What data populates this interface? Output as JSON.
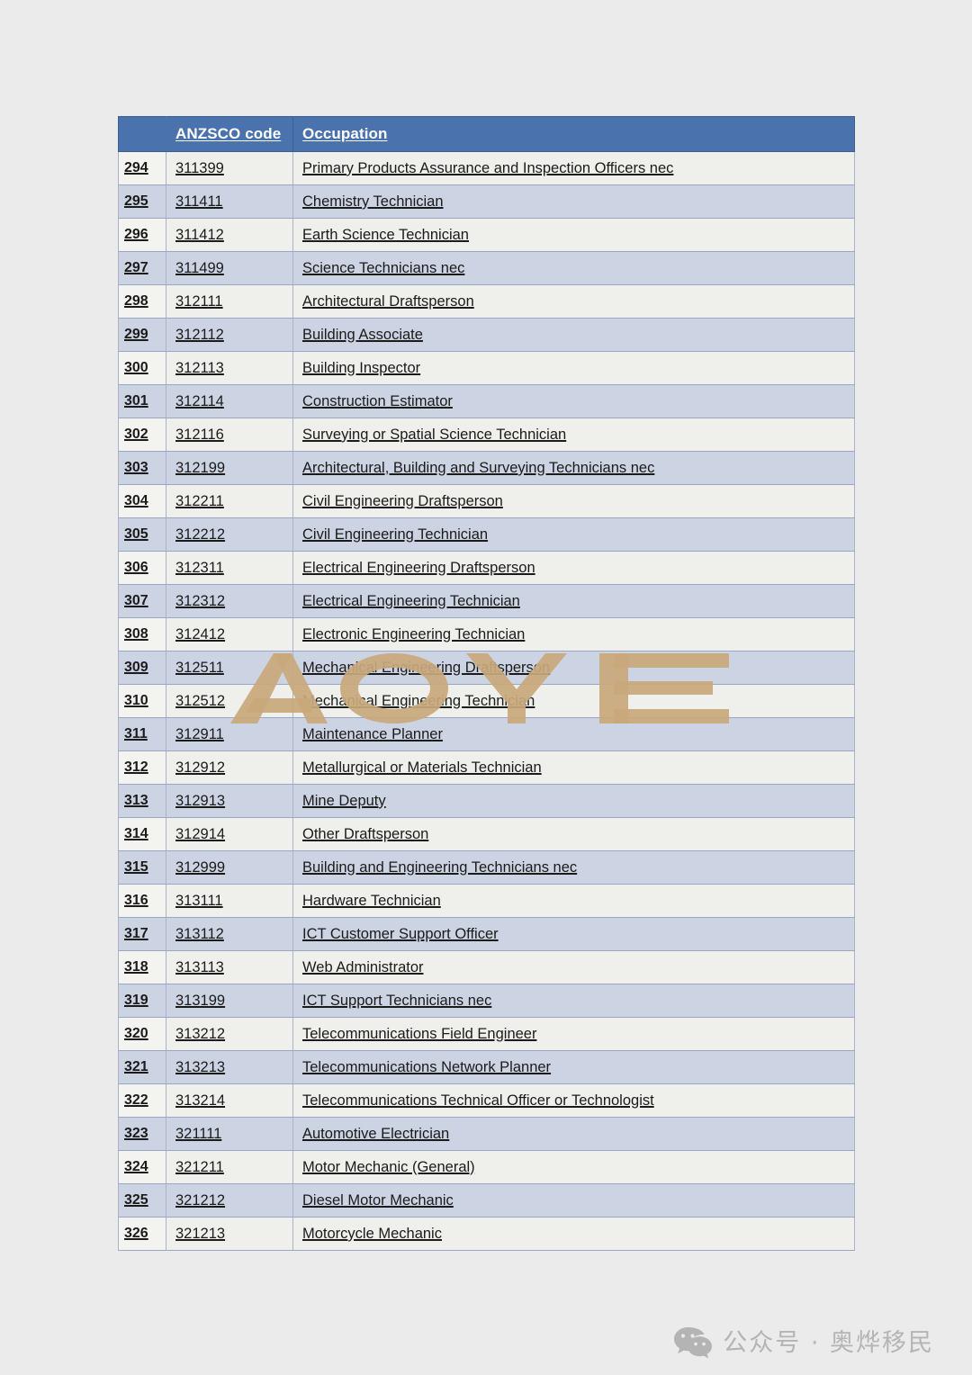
{
  "page": {
    "background_color": "#ebebeb"
  },
  "table": {
    "header": {
      "index_label": "",
      "code_label": "ANZSCO code",
      "occupation_label": "Occupation",
      "background_color": "#4a72ad",
      "text_color": "#ffffff"
    },
    "row_colors": {
      "odd": "#efefeb",
      "even": "#ccd3e3"
    },
    "rows": [
      {
        "index": "294",
        "code": "311399",
        "occupation": "Primary Products Assurance and Inspection Officers nec"
      },
      {
        "index": "295",
        "code": "311411",
        "occupation": "Chemistry Technician"
      },
      {
        "index": "296",
        "code": "311412",
        "occupation": "Earth Science Technician"
      },
      {
        "index": "297",
        "code": "311499",
        "occupation": "Science Technicians nec"
      },
      {
        "index": "298",
        "code": "312111",
        "occupation": "Architectural Draftsperson"
      },
      {
        "index": "299",
        "code": "312112",
        "occupation": "Building Associate"
      },
      {
        "index": "300",
        "code": "312113",
        "occupation": "Building Inspector"
      },
      {
        "index": "301",
        "code": "312114",
        "occupation": "Construction Estimator"
      },
      {
        "index": "302",
        "code": "312116",
        "occupation": "Surveying or Spatial Science Technician"
      },
      {
        "index": "303",
        "code": "312199",
        "occupation": "Architectural, Building and Surveying Technicians nec"
      },
      {
        "index": "304",
        "code": "312211",
        "occupation": "Civil Engineering Draftsperson"
      },
      {
        "index": "305",
        "code": "312212",
        "occupation": "Civil Engineering Technician"
      },
      {
        "index": "306",
        "code": "312311",
        "occupation": "Electrical Engineering Draftsperson"
      },
      {
        "index": "307",
        "code": "312312",
        "occupation": "Electrical Engineering Technician"
      },
      {
        "index": "308",
        "code": "312412",
        "occupation": "Electronic Engineering Technician"
      },
      {
        "index": "309",
        "code": "312511",
        "occupation": "Mechanical Engineering Draftsperson"
      },
      {
        "index": "310",
        "code": "312512",
        "occupation": "Mechanical Engineering Technician"
      },
      {
        "index": "311",
        "code": "312911",
        "occupation": "Maintenance Planner"
      },
      {
        "index": "312",
        "code": "312912",
        "occupation": "Metallurgical or Materials Technician"
      },
      {
        "index": "313",
        "code": "312913",
        "occupation": "Mine Deputy"
      },
      {
        "index": "314",
        "code": "312914",
        "occupation": "Other Draftsperson"
      },
      {
        "index": "315",
        "code": "312999",
        "occupation": "Building and Engineering Technicians nec"
      },
      {
        "index": "316",
        "code": "313111",
        "occupation": "Hardware Technician"
      },
      {
        "index": "317",
        "code": "313112",
        "occupation": "ICT Customer Support Officer"
      },
      {
        "index": "318",
        "code": "313113",
        "occupation": "Web Administrator"
      },
      {
        "index": "319",
        "code": "313199",
        "occupation": "ICT Support Technicians nec"
      },
      {
        "index": "320",
        "code": "313212",
        "occupation": "Telecommunications Field Engineer"
      },
      {
        "index": "321",
        "code": "313213",
        "occupation": "Telecommunications Network Planner"
      },
      {
        "index": "322",
        "code": "313214",
        "occupation": "Telecommunications Technical Officer or Technologist"
      },
      {
        "index": "323",
        "code": "321111",
        "occupation": "Automotive Electrician"
      },
      {
        "index": "324",
        "code": "321211",
        "occupation": "Motor Mechanic (General)"
      },
      {
        "index": "325",
        "code": "321212",
        "occupation": "Diesel Motor Mechanic"
      },
      {
        "index": "326",
        "code": "321213",
        "occupation": "Motorcycle Mechanic"
      }
    ]
  },
  "watermark": {
    "text": "AOYE",
    "color": "#c9a87c"
  },
  "footer": {
    "icon": "wechat-icon",
    "text": "公众号 · 奥烨移民",
    "color": "#b4b4b4"
  }
}
